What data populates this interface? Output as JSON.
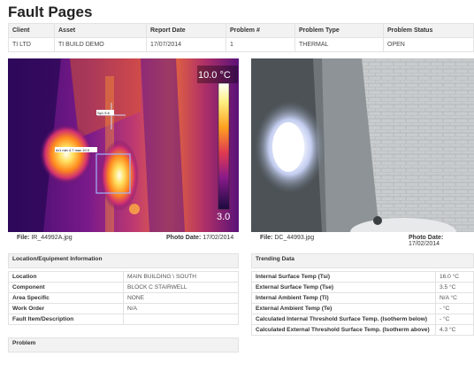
{
  "page_title": "Fault Pages",
  "header": {
    "columns": [
      "Client",
      "Asset",
      "Report Date",
      "Problem #",
      "Problem Type",
      "Problem Status"
    ],
    "row": [
      "TI LTD",
      "TI BUILD DEMO",
      "17/07/2014",
      "1",
      "THERMAL",
      "OPEN"
    ]
  },
  "ir_image": {
    "scale_max": "10.0 °C",
    "scale_min": "3.0",
    "sp_label": "Sp1 5.6",
    "ar_label": "Ar1 min 4.7 max 10.0",
    "file_label": "File:",
    "file_value": "IR_44992A.jpg",
    "date_label": "Photo Date:",
    "date_value": "17/02/2014"
  },
  "dc_image": {
    "file_label": "File:",
    "file_value": "DC_44993.jpg",
    "date_label": "Photo Date:",
    "date_value": "17/02/2014"
  },
  "location": {
    "title": "Location/Equipment Information",
    "rows": [
      {
        "k": "Location",
        "v": "MAIN BUILDING \\ SOUTH"
      },
      {
        "k": "Component",
        "v": "BLOCK C STAIRWELL"
      },
      {
        "k": "Area Specific",
        "v": "NONE"
      },
      {
        "k": "Work Order",
        "v": "N/A"
      },
      {
        "k": "Fault Item/Description",
        "v": ""
      }
    ]
  },
  "trending": {
    "title": "Trending Data",
    "rows": [
      {
        "k": "Internal Surface Temp (Tsi)",
        "v": "16.0 °C"
      },
      {
        "k": "External Surface Temp (Tse)",
        "v": "3.5 °C"
      },
      {
        "k": "Internal Ambient Temp (Ti)",
        "v": "N/A °C"
      },
      {
        "k": "External Ambient Temp (Te)",
        "v": "- °C"
      },
      {
        "k": "Calculated Internal Threshold Surface Temp. (Isotherm below)",
        "v": "- °C"
      },
      {
        "k": "Calculated External Threshold Surface Temp. (Isotherm above)",
        "v": "4.3 °C"
      }
    ]
  },
  "problem": {
    "title": "Problem"
  }
}
